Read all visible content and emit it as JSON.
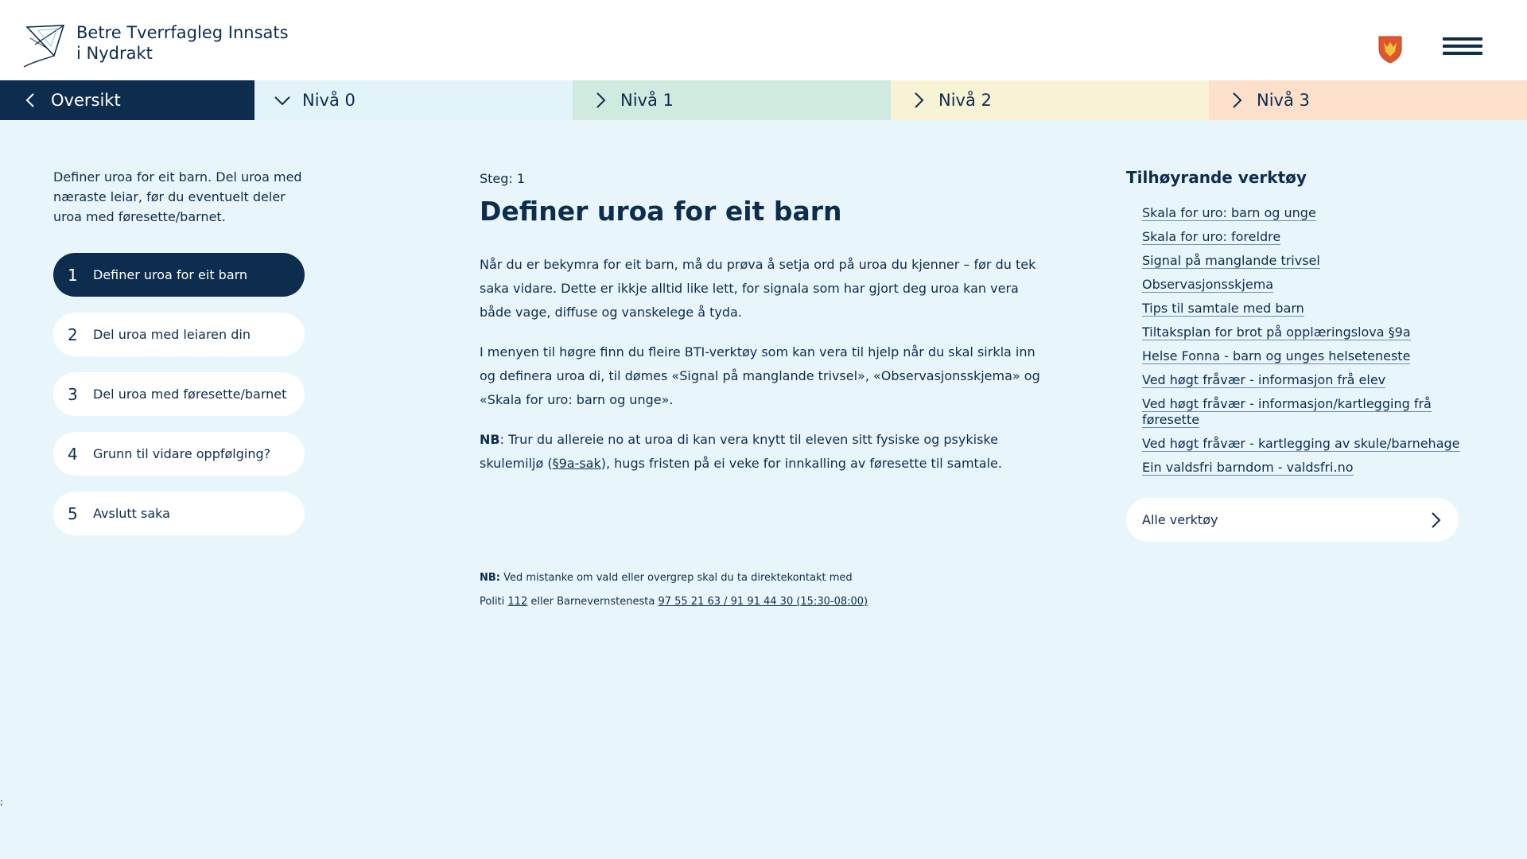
{
  "header": {
    "title_line1": "Betre Tverrfagleg Innsats",
    "title_line2": "i Nydrakt",
    "logo_icon": "kite-icon",
    "crest_icon": "municipal-crest-icon",
    "menu_icon": "hamburger-menu-icon"
  },
  "levels": [
    {
      "label": "Oversikt",
      "icon": "chevron-left-icon",
      "color": "#0e2c4d"
    },
    {
      "label": "Nivå 0",
      "icon": "chevron-down-icon",
      "color": "#e2f4fa"
    },
    {
      "label": "Nivå 1",
      "icon": "chevron-right-icon",
      "color": "#cfeadf"
    },
    {
      "label": "Nivå 2",
      "icon": "chevron-right-icon",
      "color": "#f9f3d6"
    },
    {
      "label": "Nivå 3",
      "icon": "chevron-right-icon",
      "color": "#fde0cc"
    }
  ],
  "sidebar": {
    "intro": "Definer uroa for eit barn. Del uroa med næraste leiar, før du eventuelt deler uroa med føresette/barnet.",
    "steps": [
      {
        "num": "1",
        "label": "Definer uroa for eit barn",
        "active": true
      },
      {
        "num": "2",
        "label": "Del uroa med leiaren din",
        "active": false
      },
      {
        "num": "3",
        "label": "Del uroa med føresette/barnet",
        "active": false
      },
      {
        "num": "4",
        "label": "Grunn til vidare oppfølging?",
        "active": false
      },
      {
        "num": "5",
        "label": "Avslutt saka",
        "active": false
      }
    ]
  },
  "main": {
    "step_label": "Steg: 1",
    "title": "Definer uroa for eit barn",
    "para1": "Når du er bekymra for eit barn, må du prøva å setja ord på uroa du kjenner – før du tek saka vidare. Dette er ikkje alltid like lett, for signala som har gjort deg uroa kan vera både vage, diffuse og vanskelege å tyda.",
    "para2": "I menyen til høgre finn du fleire BTI-verktøy som kan vera til hjelp når du skal sirkla inn og definera uroa di, til dømes «Signal på manglande trivsel», «Observasjonsskjema» og «Skala for uro: barn og unge».",
    "nb_label": "NB",
    "para3_a": ": Trur du allereie no at uroa di kan vera knytt til eleven sitt fysiske og psykiske skulemiljø (",
    "para3_link": "§9a-sak",
    "para3_b": "), hugs fristen på ei veke for innkalling av føresette til samtale.",
    "notice_label": "NB:",
    "notice_line1": " Ved mistanke om vald eller overgrep skal du ta direktekontakt med",
    "notice_politi": "Politi ",
    "notice_politi_num": "112",
    "notice_mid": " eller Barnevernstenesta ",
    "notice_bv_num": "97 55 21 63 / 91 91 44 30 (15:30-08:00)"
  },
  "tools": {
    "heading": "Tilhøyrande verktøy",
    "items": [
      "Skala for uro: barn og unge",
      "Skala for uro: foreldre",
      "Signal på manglande trivsel",
      "Observasjonsskjema",
      "Tips til samtale med barn",
      "Tiltaksplan for brot på opplæringslova §9a",
      "Helse Fonna - barn og unges helseteneste",
      "Ved høgt fråvær - informasjon frå elev",
      "Ved høgt fråvær - informasjon/kartlegging frå føresette",
      "Ved høgt fråvær - kartlegging av skule/barnehage",
      "Ein valdsfri barndom - valdsfri.no"
    ],
    "all_tools_label": "Alle verktøy"
  },
  "stray_text": ";"
}
